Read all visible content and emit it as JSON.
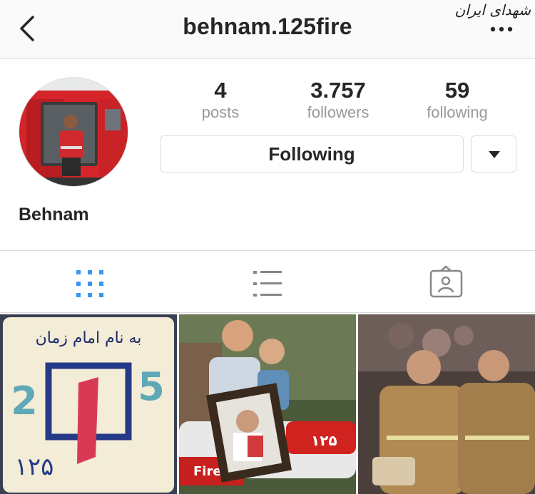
{
  "header": {
    "title": "behnam.125fire",
    "watermark": "شهدای ایران"
  },
  "profile": {
    "name": "Behnam",
    "stats": {
      "posts": {
        "value": "4",
        "label": "posts"
      },
      "followers": {
        "value": "3.757",
        "label": "followers"
      },
      "following": {
        "value": "59",
        "label": "following"
      }
    },
    "follow_button_label": "Following"
  },
  "tabs": [
    {
      "name": "grid",
      "icon": "grid-icon",
      "active": true
    },
    {
      "name": "list",
      "icon": "list-icon",
      "active": false
    },
    {
      "name": "tagged",
      "icon": "tagged-person-icon",
      "active": false
    }
  ],
  "posts": {
    "post1": {
      "top_text": "به نام امام زمان",
      "numbers_left": "2",
      "numbers_right": "5",
      "bottom_text": "۱۲۵"
    },
    "post2": {
      "plate_text": "۱۲۵",
      "fire_text": "Fire"
    },
    "post3": {
      "label": ""
    }
  },
  "colors": {
    "accent": "#3897f0",
    "text": "#262626",
    "muted": "#999999",
    "border": "#dbdbdb",
    "header_bg": "#fafafa"
  }
}
